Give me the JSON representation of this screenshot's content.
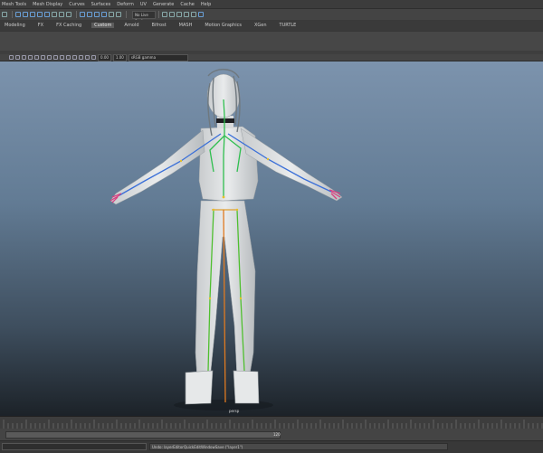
{
  "menubar": {
    "items": [
      "Mesh Tools",
      "Mesh Display",
      "Curves",
      "Surfaces",
      "Deform",
      "UV",
      "Generate",
      "Cache",
      "Help"
    ]
  },
  "statusline": {
    "no_live_surface": "No Live Surface"
  },
  "shelf_tabs": [
    {
      "label": "Modeling",
      "active": false
    },
    {
      "label": "FX",
      "active": false
    },
    {
      "label": "FX Caching",
      "active": false
    },
    {
      "label": "Custom",
      "active": true
    },
    {
      "label": "Arnold",
      "active": false
    },
    {
      "label": "Bifrost",
      "active": false
    },
    {
      "label": "MASH",
      "active": false
    },
    {
      "label": "Motion Graphics",
      "active": false
    },
    {
      "label": "XGen",
      "active": false
    },
    {
      "label": "TURTLE",
      "active": false
    }
  ],
  "panel_toolbar": {
    "value_a": "0.00",
    "value_b": "1.00",
    "color_space": "sRGB gamma"
  },
  "viewport": {
    "camera_label": "persp"
  },
  "timeline": {
    "current_frame": "120"
  },
  "command_line": {
    "feedback": "Undo: layerEditorQuickEditWindowSave (\"layer1\")"
  },
  "colors": {
    "viewport_top": "#7c93ad",
    "viewport_bottom": "#1c2228",
    "active_tab": "#5c5c5c",
    "joint_spine": "#2fbf4f",
    "joint_arm": "#3a6fd8",
    "joint_leg": "#e0a030",
    "joint_finger": "#d84080"
  }
}
